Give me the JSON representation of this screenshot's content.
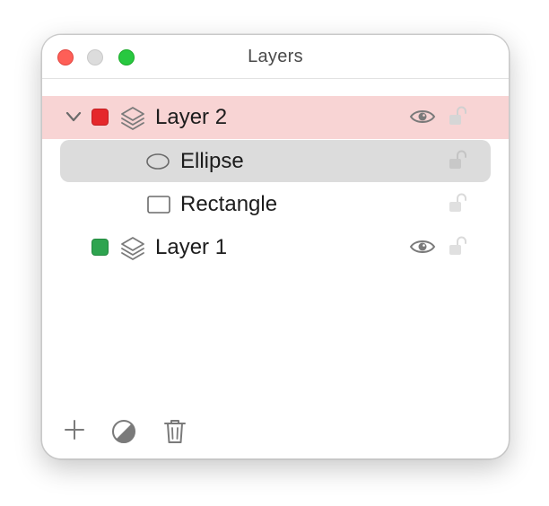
{
  "window": {
    "title": "Layers"
  },
  "layers": [
    {
      "label": "Layer 2",
      "color": "#e5282b",
      "expanded": true,
      "selected": true,
      "visible": true,
      "locked": false,
      "children": [
        {
          "label": "Ellipse",
          "shape": "ellipse-icon",
          "selected": true,
          "locked": false
        },
        {
          "label": "Rectangle",
          "shape": "rectangle-icon",
          "selected": false,
          "locked": false
        }
      ]
    },
    {
      "label": "Layer 1",
      "color": "#2ea44f",
      "expanded": false,
      "selected": false,
      "visible": true,
      "locked": false,
      "children": []
    }
  ],
  "footer": {
    "buttons": [
      "add-icon",
      "mask-icon",
      "trash-icon"
    ]
  },
  "colors": {
    "layer_selection": "#f8d4d4",
    "item_selection": "#dcdcdc",
    "icon_gray": "#8a8a8a",
    "lock_gray": "#d6d6d6"
  }
}
